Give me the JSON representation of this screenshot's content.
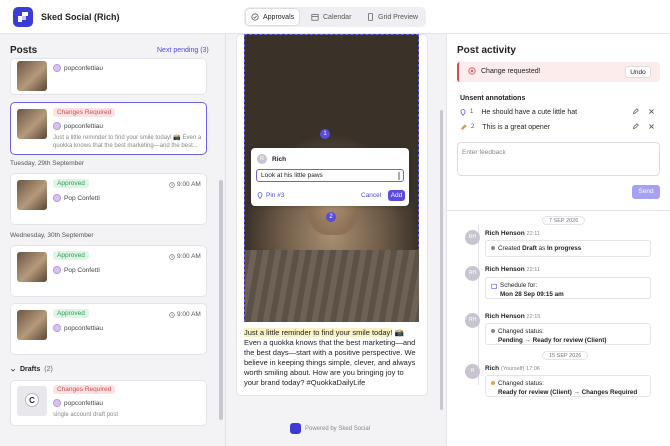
{
  "app": {
    "title": "Sked Social (Rich)"
  },
  "tabs": [
    {
      "label": "Approvals",
      "active": true
    },
    {
      "label": "Calendar",
      "active": false
    },
    {
      "label": "Grid Preview",
      "active": false
    }
  ],
  "posts": {
    "heading": "Posts",
    "next_pending": "Next pending (3)",
    "top_card": {
      "user": "popconfettiau"
    },
    "selected_card": {
      "badge": "Changes Required",
      "user": "popconfettiau",
      "text": "Just a little reminder to find your smile today! 📸 Even a quokka knows that the best marketing—and the best..."
    },
    "date1": "Tuesday, 29th September",
    "card_a": {
      "badge": "Approved",
      "time": "9:00 AM",
      "user": "Pop Confetti"
    },
    "date2": "Wednesday, 30th September",
    "card_b": {
      "badge": "Approved",
      "time": "9:00 AM",
      "user": "Pop Confetti"
    },
    "card_c": {
      "badge": "Approved",
      "time": "9:00 AM",
      "user": "popconfettiau"
    },
    "drafts_label": "Drafts",
    "drafts_count": "(2)",
    "draft_card": {
      "badge": "Changes Required",
      "user": "popconfettiau",
      "text": "single account draft post"
    }
  },
  "preview": {
    "pin1": "1",
    "pin2": "2",
    "popup_user": "Rich",
    "popup_avatar": "R",
    "popup_input": "Look at his little paws",
    "popup_pin": "Pin #3",
    "cancel": "Cancel",
    "add": "Add",
    "caption_highlight": "Just a little reminder to find your smile today!",
    "caption_rest": " 📸 Even a quokka knows that the best marketing—and the best days—start with a positive perspective. We believe in keeping things simple, clever, and always worth smiling about. How are you bringing joy to your brand today? #QuokkaDailyLife",
    "powered": "Powered by Sked Social"
  },
  "activity": {
    "title": "Post activity",
    "change_requested": "Change requested!",
    "undo": "Undo",
    "unsent_heading": "Unsent annotations",
    "annotations": [
      {
        "num": "1",
        "text": "He should have a cute little hat"
      },
      {
        "num": "2",
        "text": "This is a great opener"
      }
    ],
    "feedback_placeholder": "Enter feedback",
    "send": "Send",
    "date_sep1": "7 SEP 2026",
    "date_sep2": "15 SEP 2026",
    "events": [
      {
        "avatar": "RH",
        "name": "Rich Henson",
        "time": "22:11",
        "a": "Created ",
        "b": "Draft",
        "c": " as ",
        "d": "In progress"
      },
      {
        "avatar": "RH",
        "name": "Rich Henson",
        "time": "22:11",
        "label": "Schedule for:",
        "value": "Mon 28 Sep 09:15 am"
      },
      {
        "avatar": "RH",
        "name": "Rich Henson",
        "time": "22:15",
        "label": "Changed status:",
        "value": "Pending → Ready for review (Client)"
      },
      {
        "avatar": "R",
        "name": "Rich",
        "you": "(Yourself)",
        "time": "17:06",
        "label": "Changed status:",
        "value": "Ready for review (Client) → Changes Required"
      }
    ]
  },
  "colors": {
    "accent": "#5a4ae0",
    "danger": "#d14c4c",
    "success": "#2e9a55"
  }
}
